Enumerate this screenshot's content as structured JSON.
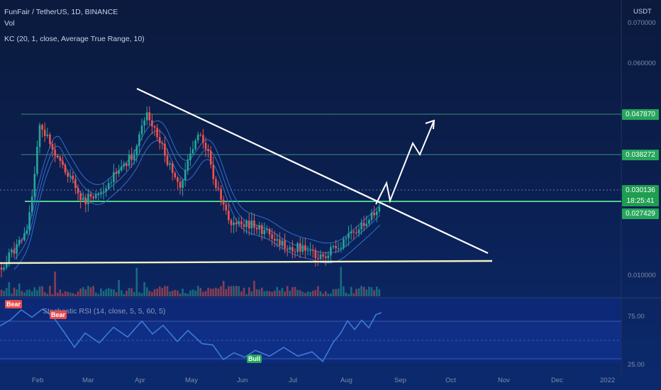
{
  "header": {
    "symbol_line": "FunFair / TetherUS, 1D, BINANCE",
    "volume_label": "Vol",
    "kc_label": "KC (20, 1, close, Average True Range, 10)"
  },
  "price_axis": {
    "currency": "USDT",
    "ticks": [
      "0.070000",
      "0.060000",
      "0.010000"
    ],
    "tags": [
      {
        "label": "0.047870",
        "color": "#26a65b"
      },
      {
        "label": "0.038272",
        "color": "#26a65b"
      },
      {
        "label": "0.030136",
        "color": "#1e9e4f"
      },
      {
        "label": "18:25:41",
        "color": "#1e9e4f"
      },
      {
        "label": "0.027429",
        "color": "#26a65b"
      }
    ]
  },
  "oscillator": {
    "title": "Stochastic RSI (14, close, 5, 5, 60, 5)",
    "ticks": [
      "75.00",
      "25.00"
    ],
    "signals": [
      "Bear",
      "Bear",
      "Bull"
    ],
    "colors": {
      "bear": "#e84b4b",
      "bull": "#23a85a",
      "line": "#3b7bd8"
    }
  },
  "time_axis": {
    "months": [
      "Feb",
      "Mar",
      "Apr",
      "May",
      "Jun",
      "Jul",
      "Aug",
      "Sep",
      "Oct",
      "Nov",
      "Dec",
      "2022"
    ]
  },
  "colors": {
    "up": "#26a69a",
    "down": "#ef5350",
    "support_green": "#4cd28a",
    "trendline": "#ffffff"
  }
}
